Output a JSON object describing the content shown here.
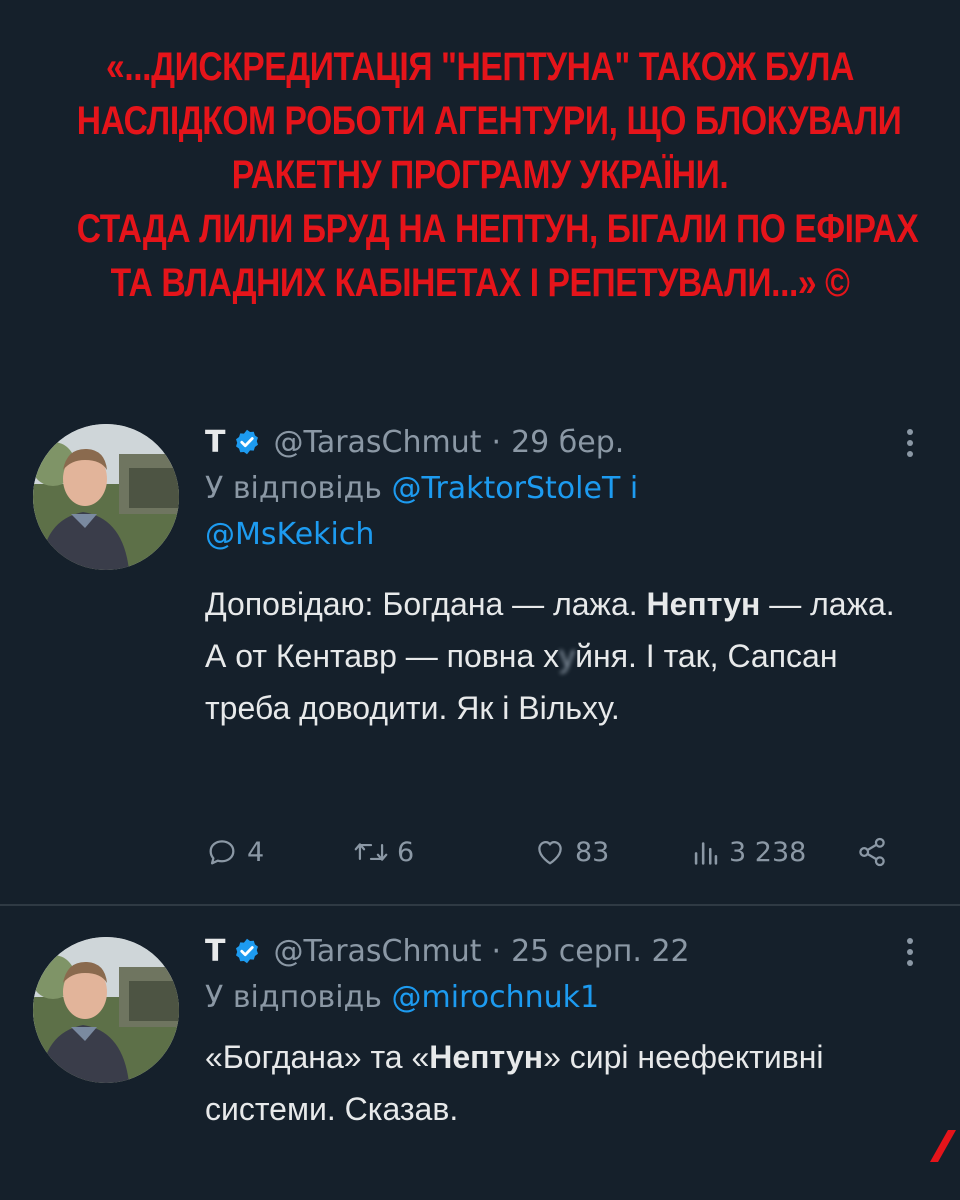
{
  "banner": {
    "lines": [
      "«...ДИСКРЕДИТАЦІЯ \"НЕПТУНА\" ТАКОЖ БУЛА",
      "НАСЛІДКОМ РОБОТИ АГЕНТУРИ, ЩО БЛОКУВАЛИ",
      "РАКЕТНУ ПРОГРАМУ УКРАЇНИ.",
      "СТАДА ЛИЛИ БРУД НА НЕПТУН, БІГАЛИ ПО ЕФІРАХ",
      "ТА ВЛАДНИХ КАБІНЕТАХ І РЕПЕТУВАЛИ...» ©"
    ],
    "color": "#e5141a"
  },
  "tweets": [
    {
      "author": "Т",
      "handle": "@TarasChmut",
      "separator": "·",
      "date": "29 бер.",
      "reply_prefix": "У відповідь",
      "reply_user1": "@TraktorStoleT",
      "reply_and": "і",
      "reply_user2": "@MsKekich",
      "text": {
        "p1": "Доповідаю: Богдана — лажа. ",
        "bold1": "Нептун",
        "p2": " — лажа. А от Кентавр — повна х",
        "censored": "у",
        "p3": "йня. І так, Сапсан треба доводити. Як і Вільху."
      },
      "replies": "4",
      "retweets": "6",
      "likes": "83",
      "views": "3 238"
    },
    {
      "author": "Т",
      "handle": "@TarasChmut",
      "separator": "·",
      "date": "25 серп. 22",
      "reply_prefix": "У відповідь",
      "reply_user1": "@mirochnuk1",
      "text": {
        "p1": "«Богдана» та «",
        "bold1": "Нептун",
        "p2": "» сирі неефективні системи. Сказав."
      }
    }
  ],
  "icons": {
    "verified": "verified-badge-icon",
    "more": "more-vertical-icon",
    "reply": "reply-icon",
    "retweet": "retweet-icon",
    "like": "heart-icon",
    "views": "views-icon",
    "share": "share-icon"
  },
  "colors": {
    "background": "#15202b",
    "link": "#1d9bf0",
    "muted": "#8b98a5",
    "text": "#e7e9ea"
  }
}
